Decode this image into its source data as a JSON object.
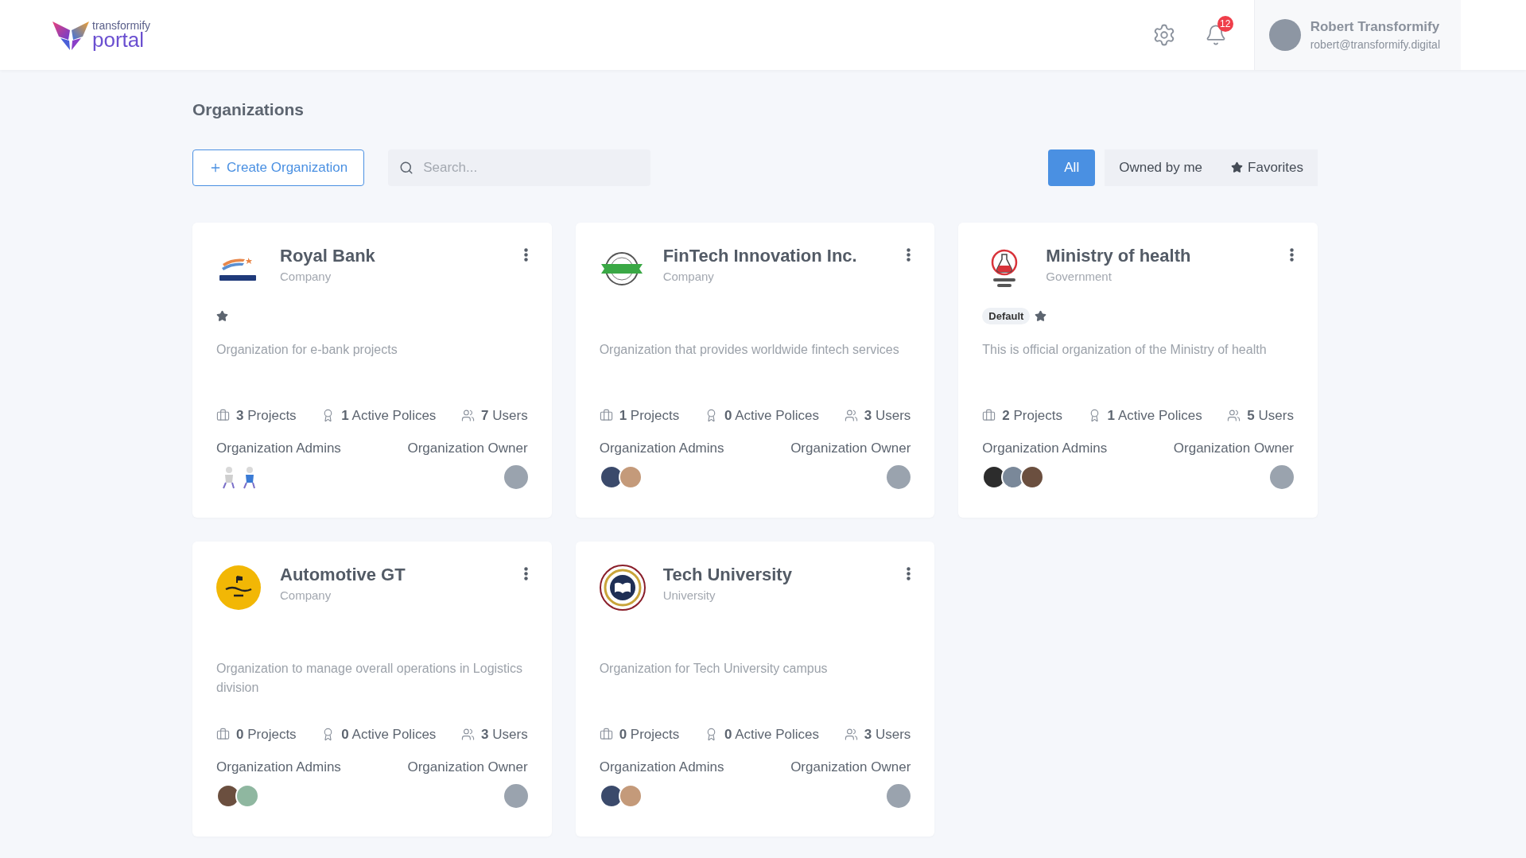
{
  "header": {
    "brand": "transformify",
    "product": "portal",
    "notification_count": "12",
    "user": {
      "name": "Robert Transformify",
      "email": "robert@transformify.digital"
    }
  },
  "page_title": "Organizations",
  "create_button": {
    "label": "Create Organization"
  },
  "search": {
    "placeholder": "Search..."
  },
  "filters": [
    {
      "label": "All",
      "selected": true,
      "kind": "plain"
    },
    {
      "label": "Owned by me",
      "selected": false,
      "kind": "plain"
    },
    {
      "label": "Favorites",
      "selected": false,
      "kind": "favorites"
    }
  ],
  "organizations": [
    {
      "name": "Royal Bank",
      "type": "Company",
      "kind": "bank",
      "favorite": true,
      "description": "Organization for e-bank projects",
      "stats": [
        {
          "value": "3",
          "label": "Projects"
        },
        {
          "value": "1",
          "label": "Active Polices"
        },
        {
          "value": "7",
          "label": "Users"
        }
      ],
      "admins_label": "Organization Admins",
      "owner_label": "Organization Owner",
      "admins": [
        {
          "kind": "illustration"
        },
        {
          "kind": "illustration"
        }
      ]
    },
    {
      "name": "FinTech Innovation Inc.",
      "type": "Company",
      "kind": "fintech",
      "favorite": false,
      "description": "Organization that provides worldwide fintech services",
      "stats": [
        {
          "value": "1",
          "label": "Projects"
        },
        {
          "value": "0",
          "label": "Active Polices"
        },
        {
          "value": "3",
          "label": "Users"
        }
      ],
      "admins_label": "Organization Admins",
      "owner_label": "Organization Owner",
      "admins": [
        {
          "kind": "photo"
        },
        {
          "kind": "photo"
        }
      ]
    },
    {
      "name": "Ministry of health",
      "type": "Government",
      "kind": "ministry",
      "badge": "Default",
      "favorite": true,
      "description": "This is official organization of the Ministry of health",
      "stats": [
        {
          "value": "2",
          "label": "Projects"
        },
        {
          "value": "1",
          "label": "Active Polices"
        },
        {
          "value": "5",
          "label": "Users"
        }
      ],
      "admins_label": "Organization Admins",
      "owner_label": "Organization Owner",
      "admins": [
        {
          "kind": "photo"
        },
        {
          "kind": "photo"
        },
        {
          "kind": "photo"
        }
      ]
    },
    {
      "name": "Automotive GT",
      "type": "Company",
      "kind": "automotive",
      "favorite": false,
      "description": "Organization to manage overall operations in Logistics division",
      "stats": [
        {
          "value": "0",
          "label": "Projects"
        },
        {
          "value": "0",
          "label": "Active Polices"
        },
        {
          "value": "3",
          "label": "Users"
        }
      ],
      "admins_label": "Organization Admins",
      "owner_label": "Organization Owner",
      "admins": [
        {
          "kind": "photo"
        },
        {
          "kind": "photo"
        }
      ]
    },
    {
      "name": "Tech University",
      "type": "University",
      "kind": "university",
      "favorite": false,
      "description": "Organization for Tech University campus",
      "stats": [
        {
          "value": "0",
          "label": "Projects"
        },
        {
          "value": "0",
          "label": "Active Polices"
        },
        {
          "value": "3",
          "label": "Users"
        }
      ],
      "admins_label": "Organization Admins",
      "owner_label": "Organization Owner",
      "admins": [
        {
          "kind": "photo"
        },
        {
          "kind": "photo"
        }
      ]
    }
  ]
}
